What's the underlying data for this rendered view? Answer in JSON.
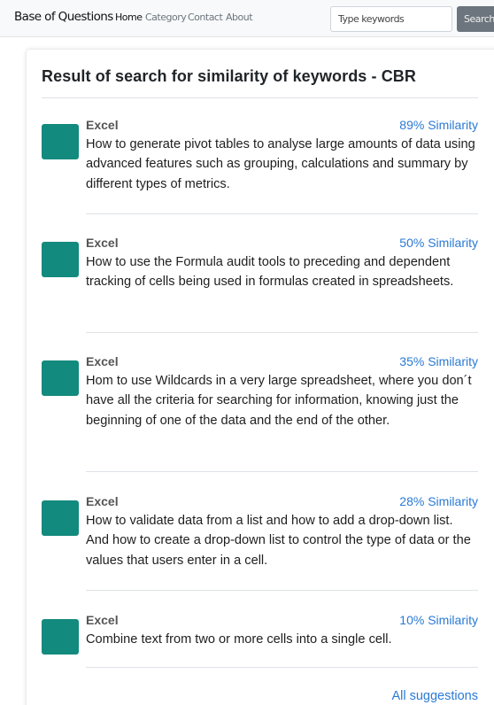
{
  "navbar": {
    "brand": "Base of Questions",
    "links": [
      "Home",
      "Category",
      "Contact",
      "About"
    ],
    "search_placeholder": "Type keywords",
    "search_button": "Search"
  },
  "results": {
    "title": "Result of search for similarity of keywords - CBR",
    "thumbnail_color": "#138a7e",
    "link_color": "#2a7ad5",
    "items": [
      {
        "category": "Excel",
        "similarity": "89% Similarity",
        "question": "How to generate pivot tables to analyse large amounts of data using advanced features such as grouping, calculations and summary by different types of metrics."
      },
      {
        "category": "Excel",
        "similarity": "50% Similarity",
        "question": "How to use the Formula audit tools to preceding and dependent tracking of cells being used in formulas created in spreadsheets."
      },
      {
        "category": "Excel",
        "similarity": "35% Similarity",
        "question": "Hom to use Wildcards in a very large spreadsheet, where you don´t have all the criteria for searching for information, knowing just the beginning of one of the data and the end of the other."
      },
      {
        "category": "Excel",
        "similarity": "28% Similarity",
        "question": "How to validate data from a list and how to add a drop-down list. And how to create a drop-down list to control the type of data or the values that users enter in a cell."
      },
      {
        "category": "Excel",
        "similarity": "10% Similarity",
        "question": "Combine text from two or more cells into a single cell."
      }
    ],
    "all_suggestions": "All suggestions"
  }
}
